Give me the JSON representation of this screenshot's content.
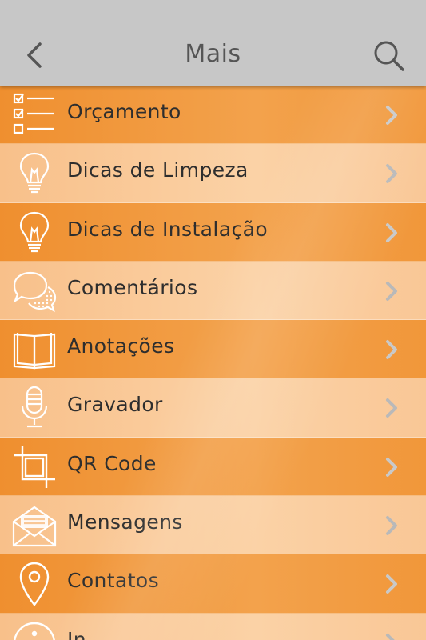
{
  "header": {
    "title": "Mais"
  },
  "menu": {
    "items": [
      {
        "label": "Orçamento",
        "icon": "checklist-icon",
        "tone": "dark"
      },
      {
        "label": "Dicas de Limpeza",
        "icon": "lightbulb-icon",
        "tone": "light"
      },
      {
        "label": "Dicas de Instalação",
        "icon": "lightbulb-icon",
        "tone": "dark"
      },
      {
        "label": "Comentários",
        "icon": "chat-bubbles-icon",
        "tone": "light"
      },
      {
        "label": "Anotações",
        "icon": "open-book-icon",
        "tone": "dark"
      },
      {
        "label": "Gravador",
        "icon": "microphone-icon",
        "tone": "light"
      },
      {
        "label": "QR Code",
        "icon": "crop-frame-icon",
        "tone": "dark"
      },
      {
        "label": "Mensagens",
        "icon": "envelope-icon",
        "tone": "light"
      },
      {
        "label": "Contatos",
        "icon": "location-pin-icon",
        "tone": "dark"
      },
      {
        "label": "In...",
        "icon": "info-icon",
        "tone": "light"
      }
    ]
  },
  "colors": {
    "header": "#c7c7c7",
    "dark_row": "#ef8f2f",
    "light_row": "#f8c08a",
    "icon": "#ffffff",
    "chevron": "#c9c9c9"
  }
}
